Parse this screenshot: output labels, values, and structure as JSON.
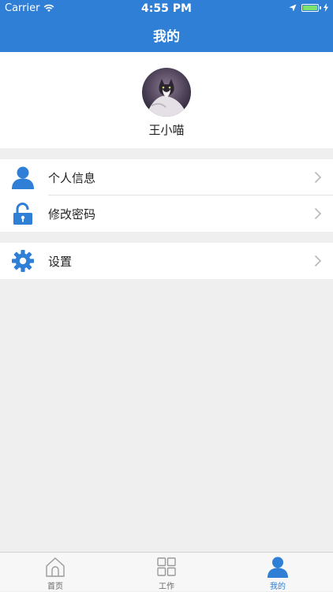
{
  "status_bar": {
    "carrier": "Carrier",
    "time": "4:55 PM",
    "battery_level": 1.0,
    "battery_color": "#7be36d"
  },
  "nav": {
    "title": "我的",
    "color": "#2f7fd6"
  },
  "profile": {
    "name": "王小喵"
  },
  "menu_group_1": [
    {
      "label": "个人信息",
      "icon": "person-icon"
    },
    {
      "label": "修改密码",
      "icon": "unlock-icon"
    }
  ],
  "menu_group_2": [
    {
      "label": "设置",
      "icon": "gear-icon"
    }
  ],
  "tabbar": {
    "items": [
      {
        "label": "首页",
        "icon": "home-icon",
        "active": false
      },
      {
        "label": "工作",
        "icon": "grid-icon",
        "active": false
      },
      {
        "label": "我的",
        "icon": "person-icon",
        "active": true
      }
    ],
    "active_color": "#2f7fd6"
  }
}
